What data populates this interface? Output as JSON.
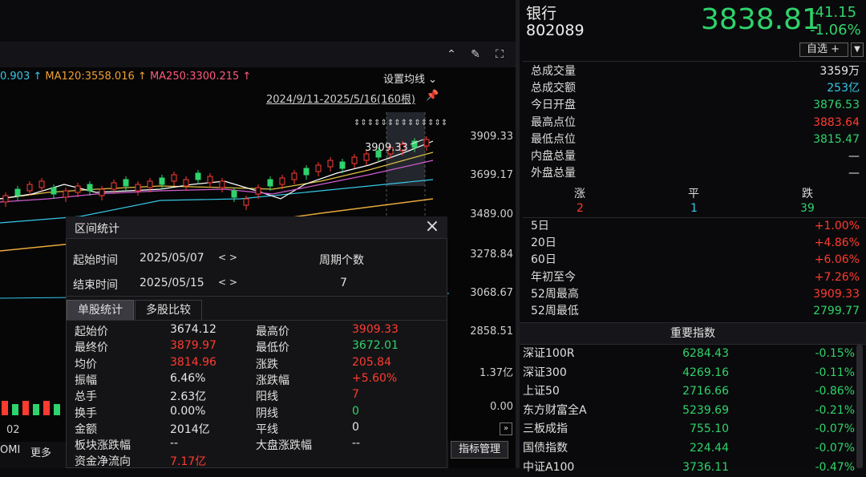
{
  "stock": {
    "name": "银行",
    "code": "802089",
    "price": "3838.81",
    "change": "-41.15",
    "change_pct": "-1.06%",
    "add_label": "自选 +",
    "add_arrow": "▼"
  },
  "quote": [
    {
      "k": "总成交量",
      "v": "3359万",
      "color": "white"
    },
    {
      "k": "总成交额",
      "v": "253亿",
      "color": "cyan"
    },
    {
      "k": "今日开盘",
      "v": "3876.53",
      "color": "green"
    },
    {
      "k": "最高点位",
      "v": "3883.64",
      "color": "red"
    },
    {
      "k": "最低点位",
      "v": "3815.47",
      "color": "green"
    },
    {
      "k": "内盘总量",
      "v": "—",
      "color": "white"
    },
    {
      "k": "外盘总量",
      "v": "—",
      "color": "white"
    }
  ],
  "breadth": {
    "up_label": "涨",
    "flat_label": "平",
    "down_label": "跌",
    "up": "2",
    "flat": "1",
    "down": "39"
  },
  "periods": [
    {
      "k": "5日",
      "v": "+1.00%"
    },
    {
      "k": "20日",
      "v": "+4.86%"
    },
    {
      "k": "60日",
      "v": "+6.06%"
    },
    {
      "k": "年初至今",
      "v": "+7.26%"
    },
    {
      "k": "52周最高",
      "v": "3909.33"
    },
    {
      "k": "52周最低",
      "v": "2799.77"
    }
  ],
  "indices_title": "重要指数",
  "indices": [
    {
      "n": "深证100R",
      "p": "6284.43",
      "c": "-0.15%"
    },
    {
      "n": "深证300",
      "p": "4269.16",
      "c": "-0.11%"
    },
    {
      "n": "上证50",
      "p": "2716.66",
      "c": "-0.86%"
    },
    {
      "n": "东方财富全A",
      "p": "5239.69",
      "c": "-0.21%"
    },
    {
      "n": "三板成指",
      "p": "755.10",
      "c": "-0.07%"
    },
    {
      "n": "国债指数",
      "p": "224.44",
      "c": "-0.07%"
    },
    {
      "n": "中证A100",
      "p": "3736.11",
      "c": "-0.47%"
    }
  ],
  "chart": {
    "ma_first": "0.903",
    "ma120": "MA120:3558.016",
    "ma250": "MA250:3300.215",
    "set_ma": "设置均线",
    "range": "2024/9/11-2025/5/16(160根)",
    "peak": "3909.33",
    "yticks": [
      "3909.33",
      "3699.17",
      "3489.00",
      "3278.84",
      "3068.67",
      "2858.51"
    ],
    "vol_ticks": [
      "1.37亿",
      "0.00"
    ],
    "x_label": "02",
    "bottom_tabs": [
      "OMI",
      "更多"
    ],
    "indicator_btn": "指标管理"
  },
  "dialog": {
    "title": "区间统计",
    "start_label": "起始时间",
    "start_date": "2025/05/07",
    "end_label": "结束时间",
    "end_date": "2025/05/15",
    "period_label": "周期个数",
    "period_count": "7",
    "nav": "< >",
    "tabs": [
      "单股统计",
      "多股比较"
    ],
    "stats_left": [
      {
        "k": "起始价",
        "v": "3674.12",
        "color": "white"
      },
      {
        "k": "最终价",
        "v": "3879.97",
        "color": "red"
      },
      {
        "k": "均价",
        "v": "3814.96",
        "color": "red"
      },
      {
        "k": "振幅",
        "v": "6.46%",
        "color": "white"
      },
      {
        "k": "总手",
        "v": "2.63亿",
        "color": "white"
      },
      {
        "k": "换手",
        "v": "0.00%",
        "color": "white"
      },
      {
        "k": "金额",
        "v": "2014亿",
        "color": "white"
      },
      {
        "k": "板块涨跌幅",
        "v": "--",
        "color": "white"
      },
      {
        "k": "资金净流向",
        "v": "7.17亿",
        "color": "red"
      }
    ],
    "stats_right": [
      {
        "k": "最高价",
        "v": "3909.33",
        "color": "red"
      },
      {
        "k": "最低价",
        "v": "3672.01",
        "color": "green"
      },
      {
        "k": "涨跌",
        "v": "205.84",
        "color": "red"
      },
      {
        "k": "涨跌幅",
        "v": "+5.60%",
        "color": "red"
      },
      {
        "k": "阳线",
        "v": "7",
        "color": "red"
      },
      {
        "k": "阴线",
        "v": "0",
        "color": "green"
      },
      {
        "k": "平线",
        "v": "0",
        "color": "white"
      },
      {
        "k": "大盘涨跌幅",
        "v": "--",
        "color": "white"
      }
    ]
  }
}
